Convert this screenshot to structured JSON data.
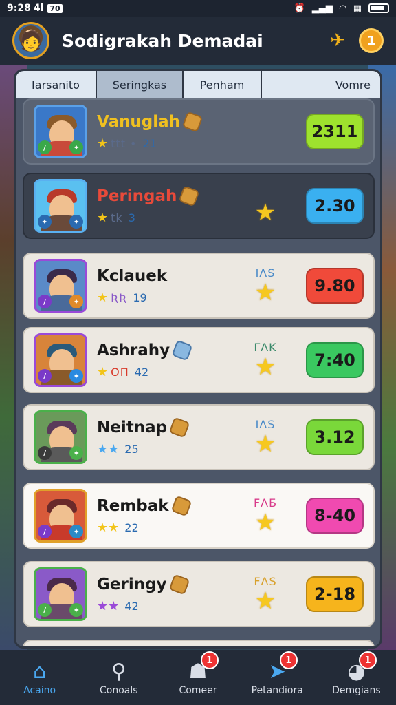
{
  "status": {
    "time": "9:28",
    "signal_text": "4l",
    "carrier": "70"
  },
  "header": {
    "title": "Sodigrakah Demadai",
    "avatar_icon": "player-avatar",
    "send_icon": "paper-plane-icon",
    "coin_icon": "coin-icon",
    "coin_label": "1"
  },
  "tabs": [
    {
      "label": "Iarsanito"
    },
    {
      "label": "Seringkas"
    },
    {
      "label": "Penham"
    },
    {
      "label": "Vomre"
    }
  ],
  "rows": [
    {
      "name": "Vanuglah",
      "stars": "★",
      "mid": "ttt •",
      "num": "21",
      "tag": "",
      "score": "2311",
      "color": "#9ee22e",
      "theme": "dark"
    },
    {
      "name": "Peringah",
      "stars": "★",
      "mid": "tk",
      "num": "3",
      "tag": "",
      "score": "2.30",
      "color": "#3ab0f0",
      "theme": "darker"
    },
    {
      "name": "Kclauek",
      "stars": "★",
      "mid": "ƦƦ",
      "num": "19",
      "tag": "IΛS",
      "score": "9.80",
      "color": "#f04a3a",
      "theme": "light"
    },
    {
      "name": "Ashrahy",
      "stars": "★",
      "mid": "ОΠ",
      "num": "42",
      "tag": "ΓΛK",
      "score": "7:40",
      "color": "#3ac860",
      "theme": "light"
    },
    {
      "name": "Neitnap",
      "stars": "★★",
      "mid": "",
      "num": "25",
      "tag": "IΛS",
      "score": "3.12",
      "color": "#7ad83a",
      "theme": "light"
    },
    {
      "name": "Rembak",
      "stars": "★★",
      "mid": "",
      "num": "22",
      "tag": "FΛБ",
      "score": "8-40",
      "color": "#f04ab0",
      "theme": "white"
    },
    {
      "name": "Geringy",
      "stars": "★★",
      "mid": "",
      "num": "42",
      "tag": "FΛS",
      "score": "2-18",
      "color": "#f6b41c",
      "theme": "light"
    }
  ],
  "nav": [
    {
      "label": "Acaino",
      "icon": "home-icon",
      "badge": ""
    },
    {
      "label": "Conoals",
      "icon": "search-icon",
      "badge": ""
    },
    {
      "label": "Comeer",
      "icon": "chat-icon",
      "badge": "1"
    },
    {
      "label": "Petandiora",
      "icon": "send-icon",
      "badge": "1"
    },
    {
      "label": "Demgians",
      "icon": "profile-icon",
      "badge": "1"
    }
  ]
}
